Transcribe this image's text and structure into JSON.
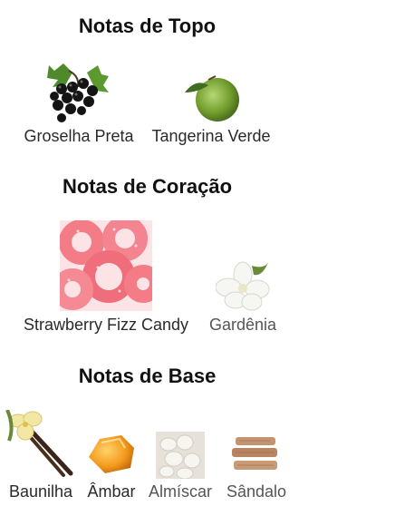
{
  "sections": [
    {
      "title": "Notas de Topo",
      "notes": [
        {
          "label": "Groselha Preta",
          "icon": "blackcurrant-icon"
        },
        {
          "label": "Tangerina Verde",
          "icon": "green-tangerine-icon"
        }
      ]
    },
    {
      "title": "Notas de Coração",
      "notes": [
        {
          "label": "Strawberry Fizz Candy",
          "icon": "strawberry-candy-icon"
        },
        {
          "label": "Gardênia",
          "icon": "gardenia-icon"
        }
      ]
    },
    {
      "title": "Notas de Base",
      "notes": [
        {
          "label": "Baunilha",
          "icon": "vanilla-icon"
        },
        {
          "label": "Âmbar",
          "icon": "amber-icon"
        },
        {
          "label": "Almíscar",
          "icon": "musk-icon"
        },
        {
          "label": "Sândalo",
          "icon": "sandalwood-icon"
        }
      ]
    }
  ]
}
